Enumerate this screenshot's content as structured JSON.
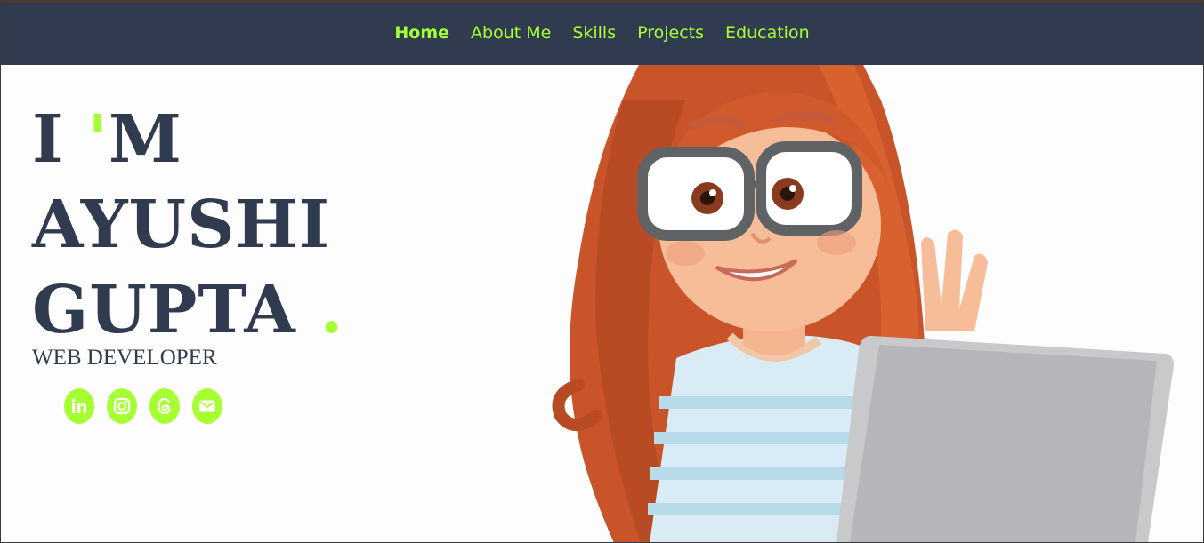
{
  "nav": {
    "items": [
      {
        "label": "Home",
        "active": true
      },
      {
        "label": "About Me",
        "active": false
      },
      {
        "label": "Skills",
        "active": false
      },
      {
        "label": "Projects",
        "active": false
      },
      {
        "label": "Education",
        "active": false
      }
    ]
  },
  "hero": {
    "line1_a": "I ",
    "line1_apostrophe": "'",
    "line1_b": "M",
    "line2": "AYUSHI",
    "line3": "GUPTA ",
    "line3_dot": ".",
    "role": "WEB DEVELOPER"
  },
  "socials": [
    {
      "icon": "linkedin-icon"
    },
    {
      "icon": "instagram-icon"
    },
    {
      "icon": "threads-icon"
    },
    {
      "icon": "email-icon"
    }
  ],
  "colors": {
    "navbar_bg": "#313b50",
    "accent": "#a6ff33",
    "text_dark": "#313b50",
    "page_bg": "#fdfdfd"
  }
}
